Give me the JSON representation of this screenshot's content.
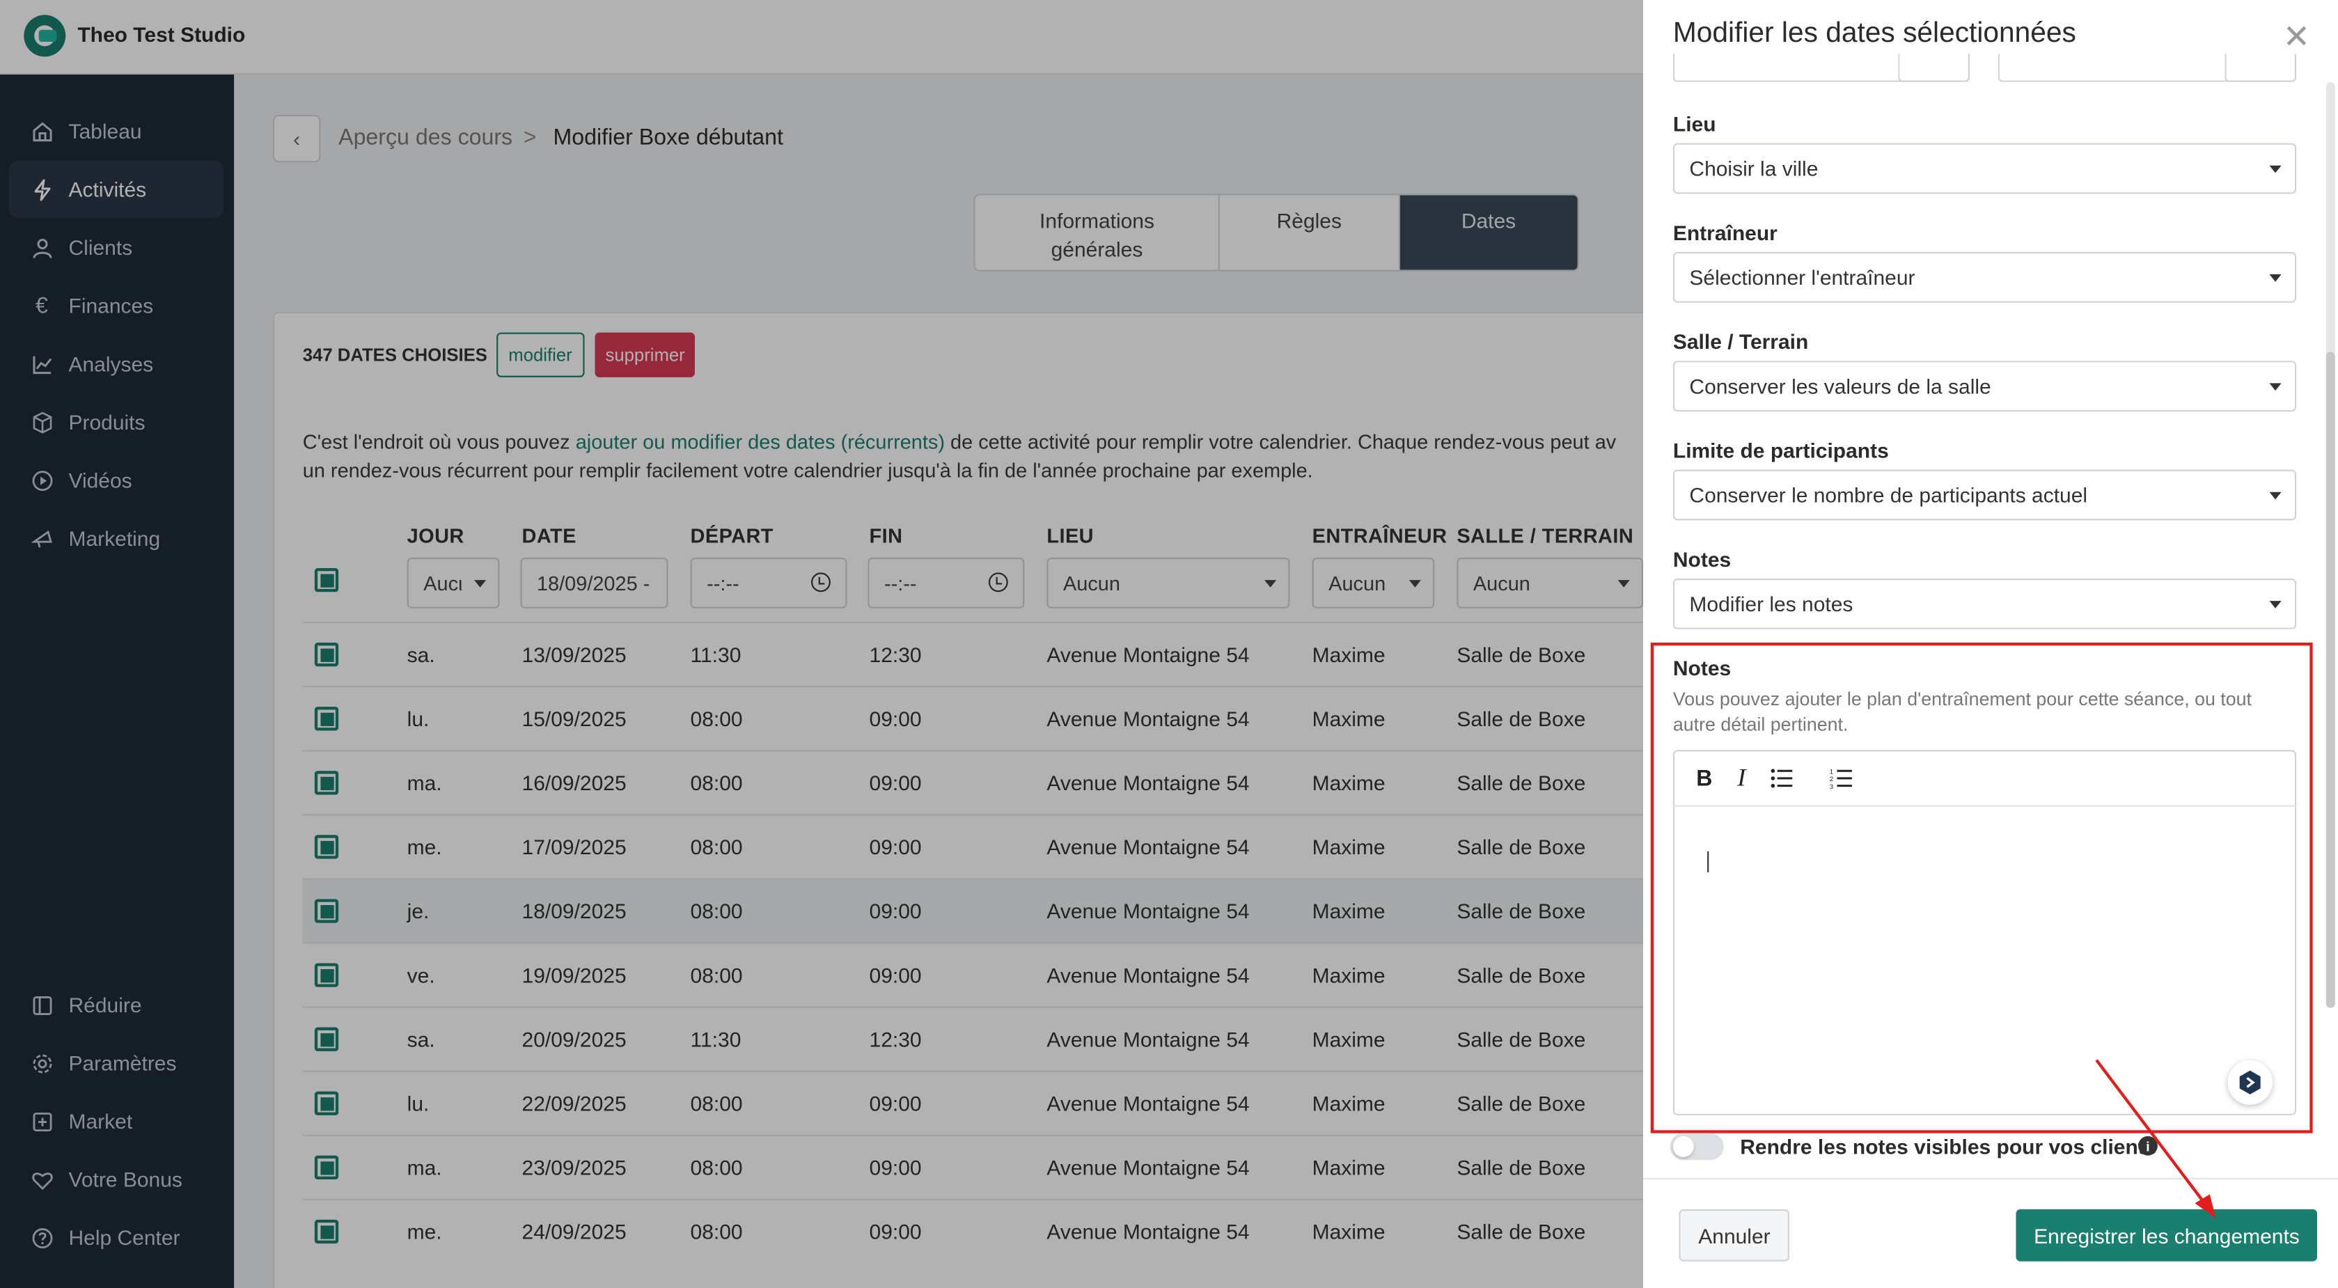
{
  "app": {
    "studio_name": "Theo Test Studio"
  },
  "sidebar": {
    "items": [
      {
        "label": "Tableau",
        "icon": "home-icon"
      },
      {
        "label": "Activités",
        "icon": "bolt-icon",
        "active": true
      },
      {
        "label": "Clients",
        "icon": "user-icon"
      },
      {
        "label": "Finances",
        "icon": "euro-icon"
      },
      {
        "label": "Analyses",
        "icon": "chart-line-icon"
      },
      {
        "label": "Produits",
        "icon": "box-icon"
      },
      {
        "label": "Vidéos",
        "icon": "play-icon"
      },
      {
        "label": "Marketing",
        "icon": "megaphone-icon"
      }
    ],
    "bottom_items": [
      {
        "label": "Réduire",
        "icon": "collapse-icon"
      },
      {
        "label": "Paramètres",
        "icon": "gear-icon"
      },
      {
        "label": "Market",
        "icon": "plus-square-icon"
      },
      {
        "label": "Votre Bonus",
        "icon": "heart-icon"
      },
      {
        "label": "Help Center",
        "icon": "help-icon"
      }
    ]
  },
  "breadcrumb": {
    "parent": "Aperçu des cours",
    "separator": ">",
    "current": "Modifier Boxe débutant"
  },
  "tabs": [
    {
      "label": "Informations générales"
    },
    {
      "label": "Règles"
    },
    {
      "label": "Dates",
      "active": true
    }
  ],
  "dates_section": {
    "count_label": "347 DATES CHOISIES",
    "modify_label": "modifier",
    "delete_label": "supprimer",
    "info_prefix": "C'est l'endroit où vous pouvez ",
    "info_link": "ajouter ou modifier des dates (récurrents)",
    "info_suffix": " de cette activité pour remplir votre calendrier. Chaque rendez-vous peut av",
    "info_line2": "un rendez-vous récurrent pour remplir facilement votre calendrier jusqu'à la fin de l'année prochaine par exemple."
  },
  "table": {
    "headers": [
      "JOUR",
      "DATE",
      "DÉPART",
      "FIN",
      "LIEU",
      "ENTRAÎNEUR",
      "SALLE / TERRAIN"
    ],
    "filters": {
      "jour": "Aucι",
      "date": "18/09/2025 -",
      "depart": "--:--",
      "fin": "--:--",
      "lieu": "Aucun",
      "entraineur": "Aucun",
      "salle": "Aucun"
    },
    "rows": [
      {
        "day": "sa.",
        "date": "13/09/2025",
        "start": "11:30",
        "end": "12:30",
        "location": "Avenue Montaigne 54",
        "trainer": "Maxime",
        "room": "Salle de Boxe"
      },
      {
        "day": "lu.",
        "date": "15/09/2025",
        "start": "08:00",
        "end": "09:00",
        "location": "Avenue Montaigne 54",
        "trainer": "Maxime",
        "room": "Salle de Boxe"
      },
      {
        "day": "ma.",
        "date": "16/09/2025",
        "start": "08:00",
        "end": "09:00",
        "location": "Avenue Montaigne 54",
        "trainer": "Maxime",
        "room": "Salle de Boxe"
      },
      {
        "day": "me.",
        "date": "17/09/2025",
        "start": "08:00",
        "end": "09:00",
        "location": "Avenue Montaigne 54",
        "trainer": "Maxime",
        "room": "Salle de Boxe"
      },
      {
        "day": "je.",
        "date": "18/09/2025",
        "start": "08:00",
        "end": "09:00",
        "location": "Avenue Montaigne 54",
        "trainer": "Maxime",
        "room": "Salle de Boxe",
        "highlight": true
      },
      {
        "day": "ve.",
        "date": "19/09/2025",
        "start": "08:00",
        "end": "09:00",
        "location": "Avenue Montaigne 54",
        "trainer": "Maxime",
        "room": "Salle de Boxe"
      },
      {
        "day": "sa.",
        "date": "20/09/2025",
        "start": "11:30",
        "end": "12:30",
        "location": "Avenue Montaigne 54",
        "trainer": "Maxime",
        "room": "Salle de Boxe"
      },
      {
        "day": "lu.",
        "date": "22/09/2025",
        "start": "08:00",
        "end": "09:00",
        "location": "Avenue Montaigne 54",
        "trainer": "Maxime",
        "room": "Salle de Boxe"
      },
      {
        "day": "ma.",
        "date": "23/09/2025",
        "start": "08:00",
        "end": "09:00",
        "location": "Avenue Montaigne 54",
        "trainer": "Maxime",
        "room": "Salle de Boxe"
      },
      {
        "day": "me.",
        "date": "24/09/2025",
        "start": "08:00",
        "end": "09:00",
        "location": "Avenue Montaigne 54",
        "trainer": "Maxime",
        "room": "Salle de Boxe"
      }
    ]
  },
  "drawer": {
    "title": "Modifier les dates sélectionnées",
    "close_icon": "close-icon",
    "fields": [
      {
        "label": "Lieu",
        "value": "Choisir la ville"
      },
      {
        "label": "Entraîneur",
        "value": "Sélectionner l'entraîneur"
      },
      {
        "label": "Salle / Terrain",
        "value": "Conserver les valeurs de la salle"
      },
      {
        "label": "Limite de participants",
        "value": "Conserver le nombre de participants actuel"
      },
      {
        "label": "Notes",
        "value": "Modifier les notes"
      }
    ],
    "notes_editor": {
      "label": "Notes",
      "help": "Vous pouvez ajouter le plan d'entraînement pour cette séance, ou tout autre détail pertinent.",
      "toolbar": [
        "bold-icon",
        "italic-icon",
        "bullet-list-icon",
        "numbered-list-icon"
      ],
      "value": ""
    },
    "visibility_toggle": {
      "label": "Rendre les notes visibles pour vos clients",
      "on": false
    },
    "cancel_label": "Annuler",
    "save_label": "Enregistrer les changements"
  },
  "colors": {
    "brand": "#1a7f6e",
    "danger": "#d93954",
    "sidebar": "#1f2a37",
    "annotation": "#e21d1d"
  }
}
